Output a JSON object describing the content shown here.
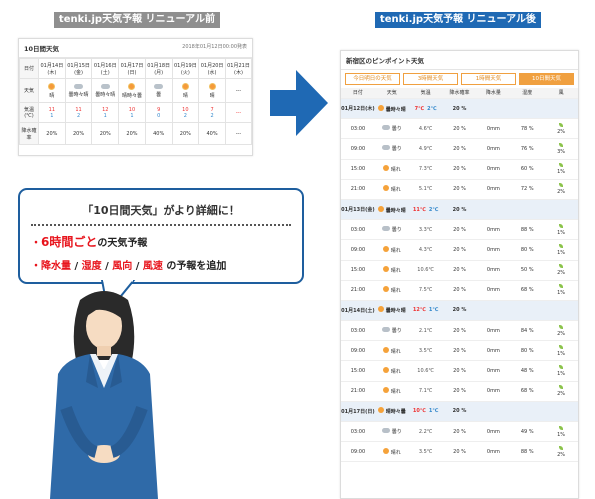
{
  "old": {
    "label": "tenki.jp天気予報 リニューアル前",
    "panel_title": "10日間天気",
    "timestamp": "2018年01月12日00:00発表",
    "rows": {
      "date": "日付",
      "weather": "天気",
      "temp": "気温(℃)",
      "precip": "降水確率"
    },
    "days": [
      {
        "date": "01月14日(木)",
        "weather": "晴",
        "hi": "11",
        "lo": "1",
        "precip": "20%"
      },
      {
        "date": "01月15日(金)",
        "weather": "曇時々晴",
        "hi": "11",
        "lo": "2",
        "precip": "20%"
      },
      {
        "date": "01月16日(土)",
        "weather": "曇時々晴",
        "hi": "12",
        "lo": "1",
        "precip": "20%"
      },
      {
        "date": "01月17日(日)",
        "weather": "晴時々曇",
        "hi": "10",
        "lo": "1",
        "precip": "20%"
      },
      {
        "date": "01月18日(月)",
        "weather": "曇",
        "hi": "9",
        "lo": "0",
        "precip": "40%"
      },
      {
        "date": "01月19日(火)",
        "weather": "晴",
        "hi": "10",
        "lo": "2",
        "precip": "20%"
      },
      {
        "date": "01月20日(水)",
        "weather": "晴",
        "hi": "7",
        "lo": "2",
        "precip": "40%"
      },
      {
        "date": "01月21日(木)",
        "weather": "---",
        "hi": "---",
        "lo": "",
        "precip": "---"
      }
    ]
  },
  "new": {
    "label": "tenki.jp天気予報 リニューアル後",
    "panel_title": "新宿区のピンポイント天気",
    "tabs": [
      "今日明日の天気",
      "3時間天気",
      "1時間天気",
      "10日間天気"
    ],
    "cols": [
      "日付",
      "天気",
      "気温",
      "降水確率",
      "降水量",
      "湿度",
      "風"
    ],
    "groups": [
      {
        "day": "01月12日(木)",
        "weather": "曇時々晴",
        "hi": "7℃",
        "lo": "2℃",
        "precip": "20 %",
        "rows": [
          {
            "time": "03:00",
            "weather": "曇り",
            "temp": "4.6℃",
            "precip": "20 %",
            "amount": "0mm",
            "hum": "78 %",
            "wind": "2%"
          },
          {
            "time": "09:00",
            "weather": "曇り",
            "temp": "4.9℃",
            "precip": "20 %",
            "amount": "0mm",
            "hum": "76 %",
            "wind": "3%"
          },
          {
            "time": "15:00",
            "weather": "晴れ",
            "temp": "7.3℃",
            "precip": "20 %",
            "amount": "0mm",
            "hum": "60 %",
            "wind": "1%"
          },
          {
            "time": "21:00",
            "weather": "晴れ",
            "temp": "5.1℃",
            "precip": "20 %",
            "amount": "0mm",
            "hum": "72 %",
            "wind": "2%"
          }
        ]
      },
      {
        "day": "01月13日(金)",
        "weather": "曇時々晴",
        "hi": "11℃",
        "lo": "2℃",
        "precip": "20 %",
        "rows": [
          {
            "time": "03:00",
            "weather": "曇り",
            "temp": "3.3℃",
            "precip": "20 %",
            "amount": "0mm",
            "hum": "88 %",
            "wind": "1%"
          },
          {
            "time": "09:00",
            "weather": "晴れ",
            "temp": "4.3℃",
            "precip": "20 %",
            "amount": "0mm",
            "hum": "80 %",
            "wind": "1%"
          },
          {
            "time": "15:00",
            "weather": "晴れ",
            "temp": "10.6℃",
            "precip": "20 %",
            "amount": "0mm",
            "hum": "50 %",
            "wind": "2%"
          },
          {
            "time": "21:00",
            "weather": "晴れ",
            "temp": "7.5℃",
            "precip": "20 %",
            "amount": "0mm",
            "hum": "68 %",
            "wind": "1%"
          }
        ]
      },
      {
        "day": "01月14日(土)",
        "weather": "曇時々晴",
        "hi": "12℃",
        "lo": "1℃",
        "precip": "20 %",
        "rows": [
          {
            "time": "03:00",
            "weather": "曇り",
            "temp": "2.1℃",
            "precip": "20 %",
            "amount": "0mm",
            "hum": "84 %",
            "wind": "2%"
          },
          {
            "time": "09:00",
            "weather": "晴れ",
            "temp": "3.5℃",
            "precip": "20 %",
            "amount": "0mm",
            "hum": "80 %",
            "wind": "1%"
          },
          {
            "time": "15:00",
            "weather": "晴れ",
            "temp": "10.6℃",
            "precip": "20 %",
            "amount": "0mm",
            "hum": "48 %",
            "wind": "1%"
          },
          {
            "time": "21:00",
            "weather": "晴れ",
            "temp": "7.1℃",
            "precip": "20 %",
            "amount": "0mm",
            "hum": "68 %",
            "wind": "2%"
          }
        ]
      },
      {
        "day": "01月17日(日)",
        "weather": "晴時々曇",
        "hi": "10℃",
        "lo": "1℃",
        "precip": "20 %",
        "rows": [
          {
            "time": "03:00",
            "weather": "曇り",
            "temp": "2.2℃",
            "precip": "20 %",
            "amount": "0mm",
            "hum": "49 %",
            "wind": "1%"
          },
          {
            "time": "09:00",
            "weather": "晴れ",
            "temp": "3.5℃",
            "precip": "20 %",
            "amount": "0mm",
            "hum": "88 %",
            "wind": "2%"
          }
        ]
      }
    ]
  },
  "callout": {
    "title": "「10日間天気」がより詳細に！",
    "line1_em": "6時間ごと",
    "line1_rest": "の天気予報",
    "line2_parts": [
      "降水量",
      "/",
      "湿度",
      "/",
      "風向",
      "/",
      "風速",
      "の予報を追加"
    ]
  }
}
